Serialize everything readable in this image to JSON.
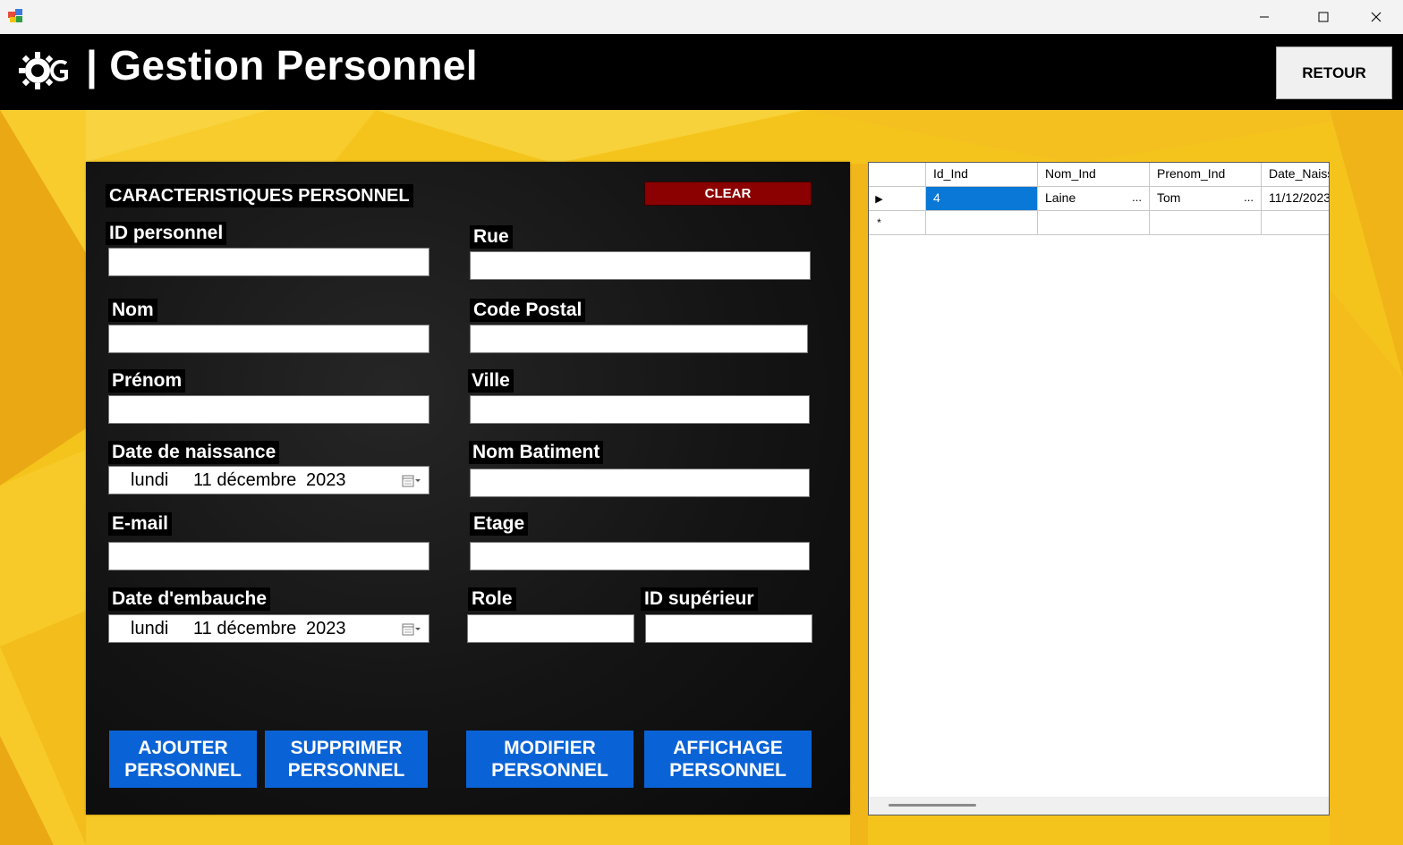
{
  "window": {
    "minimize_glyph": "—",
    "maximize_glyph": "☐",
    "close_glyph": "✕"
  },
  "header": {
    "title": "| Gestion Personnel",
    "back_button": "RETOUR",
    "logo_icon": "gear-g-logo-icon"
  },
  "form": {
    "section_title": "CARACTERISTIQUES PERSONNEL",
    "clear_button": "CLEAR",
    "fields": {
      "id_personnel": {
        "label": "ID personnel",
        "value": ""
      },
      "nom": {
        "label": "Nom",
        "value": ""
      },
      "prenom": {
        "label": "Prénom",
        "value": ""
      },
      "date_naissance": {
        "label": "Date de naissance",
        "day": "lundi",
        "date": "11 décembre",
        "year": "2023"
      },
      "email": {
        "label": "E-mail",
        "value": ""
      },
      "date_embauche": {
        "label": "Date d'embauche",
        "day": "lundi",
        "date": "11 décembre",
        "year": "2023"
      },
      "rue": {
        "label": "Rue",
        "value": ""
      },
      "code_postal": {
        "label": "Code Postal",
        "value": ""
      },
      "ville": {
        "label": "Ville",
        "value": ""
      },
      "nom_batiment": {
        "label": "Nom Batiment",
        "value": ""
      },
      "etage": {
        "label": "Etage",
        "value": ""
      },
      "role": {
        "label": "Role",
        "value": ""
      },
      "id_superieur": {
        "label": "ID supérieur",
        "value": ""
      }
    },
    "buttons": {
      "ajouter": [
        "AJOUTER",
        "PERSONNEL"
      ],
      "supprimer": [
        "SUPPRIMER",
        "PERSONNEL"
      ],
      "modifier": [
        "MODIFIER",
        "PERSONNEL"
      ],
      "affichage": [
        "AFFICHAGE",
        "PERSONNEL"
      ]
    }
  },
  "grid": {
    "columns": [
      "Id_Ind",
      "Nom_Ind",
      "Prenom_Ind",
      "Date_Naiss"
    ],
    "rows": [
      {
        "cells": [
          "4",
          "Laine",
          "Tom",
          "11/12/2023"
        ],
        "ellipsis": "..."
      }
    ],
    "current_row_marker": "▶",
    "new_row_marker": "*"
  },
  "colors": {
    "header_bg": "#000000",
    "clear_button": "#8b0000",
    "action_button": "#0a63d6",
    "grid_selection": "#0a78d7"
  }
}
